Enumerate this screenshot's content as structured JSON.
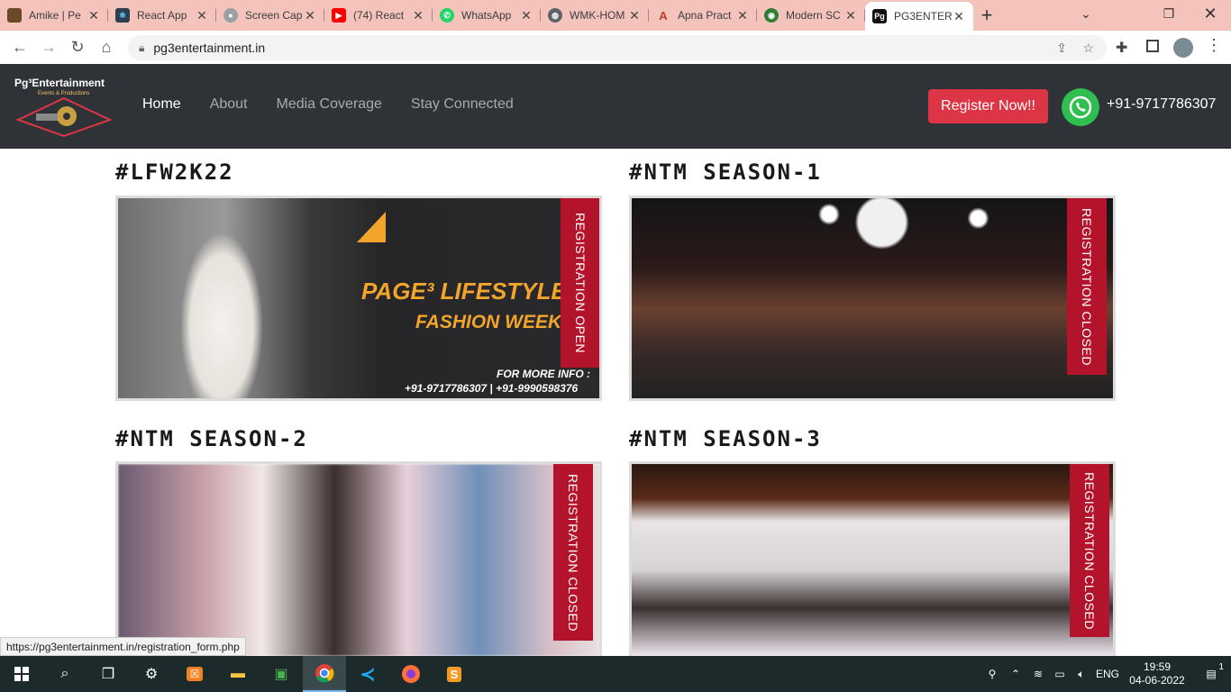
{
  "browser": {
    "tabs": [
      {
        "title": "Amike | Pe",
        "color": "#6b4a2a"
      },
      {
        "title": "React App",
        "color": "#2c3e50"
      },
      {
        "title": "Screen Cap",
        "color": "#9aa0a6"
      },
      {
        "title": "(74) React",
        "color": "#ff0000"
      },
      {
        "title": "WhatsApp",
        "color": "#25d366"
      },
      {
        "title": "WMK-HOM",
        "color": "#5f6368"
      },
      {
        "title": "Apna Pract",
        "color": "#c0392b"
      },
      {
        "title": "Modern SC",
        "color": "#2e7d32"
      },
      {
        "title": "PG3ENTER",
        "color": "#111111"
      }
    ],
    "url": "pg3entertainment.in"
  },
  "site": {
    "logo_text": "Pg³Entertainment",
    "logo_sub": "Events & Productions",
    "menu": [
      "Home",
      "About",
      "Media Coverage",
      "Stay Connected"
    ],
    "register_label": "Register Now!!",
    "phone": "+91-9717786307"
  },
  "events": [
    {
      "heading": "#LFW2K22",
      "ribbon": "REGISTRATION OPEN",
      "banner_title": "PAGE³ LIFESTYLE",
      "banner_sub": "FASHION WEEK",
      "banner_info": "FOR MORE INFO :",
      "banner_phones": "+91-9717786307 | +91-9990598376"
    },
    {
      "heading": "#NTM SEASON-1",
      "ribbon": "REGISTRATION CLOSED"
    },
    {
      "heading": "#NTM SEASON-2",
      "ribbon": "REGISTRATION CLOSED"
    },
    {
      "heading": "#NTM SEASON-3",
      "ribbon": "REGISTRATION CLOSED"
    }
  ],
  "status_url": "https://pg3entertainment.in/registration_form.php",
  "taskbar": {
    "lang": "ENG",
    "time": "19:59",
    "date": "04-06-2022",
    "notifications": "1"
  },
  "colors": {
    "accent": "#dc3545",
    "nav_bg": "#2f3338",
    "ribbon": "#b3132b"
  }
}
